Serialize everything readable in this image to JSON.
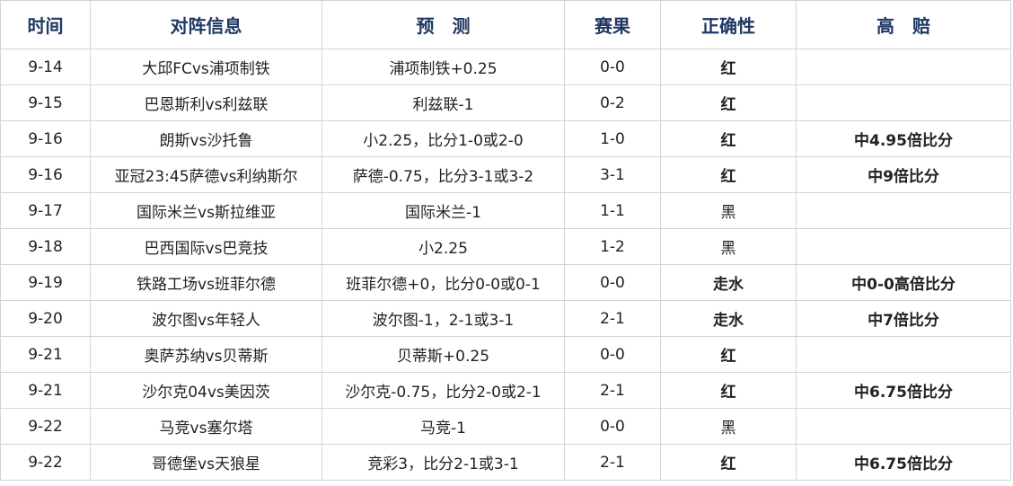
{
  "colors": {
    "header_text": "#1f3864",
    "red": "#e32020",
    "blue": "#1ba1e2",
    "black": "#222222",
    "grid": "#d4d4d4"
  },
  "headers": [
    "时间",
    "对阵信息",
    "预　测",
    "赛果",
    "正确性",
    "高　赔"
  ],
  "rows": [
    {
      "date": "9-14",
      "match": "大邱FCvs浦项制铁",
      "prediction": "浦项制铁+0.25",
      "score": "0-0",
      "result": "红",
      "result_type": "red",
      "odds": ""
    },
    {
      "date": "9-15",
      "match": "巴恩斯利vs利兹联",
      "prediction": "利兹联-1",
      "score": "0-2",
      "result": "红",
      "result_type": "red",
      "odds": ""
    },
    {
      "date": "9-16",
      "match": "朗斯vs沙托鲁",
      "prediction": "小2.25，比分1-0或2-0",
      "score": "1-0",
      "result": "红",
      "result_type": "red",
      "odds": "中4.95倍比分"
    },
    {
      "date": "9-16",
      "match": "亚冠23:45萨德vs利纳斯尔",
      "prediction": "萨德-0.75，比分3-1或3-2",
      "score": "3-1",
      "result": "红",
      "result_type": "red",
      "odds": "中9倍比分"
    },
    {
      "date": "9-17",
      "match": "国际米兰vs斯拉维亚",
      "prediction": "国际米兰-1",
      "score": "1-1",
      "result": "黑",
      "result_type": "black",
      "odds": ""
    },
    {
      "date": "9-18",
      "match": "巴西国际vs巴竞技",
      "prediction": "小2.25",
      "score": "1-2",
      "result": "黑",
      "result_type": "black",
      "odds": ""
    },
    {
      "date": "9-19",
      "match": "铁路工场vs班菲尔德",
      "prediction": "班菲尔德+0，比分0-0或0-1",
      "score": "0-0",
      "result": "走水",
      "result_type": "blue",
      "odds": "中0-0高倍比分"
    },
    {
      "date": "9-20",
      "match": "波尔图vs年轻人",
      "prediction": "波尔图-1，2-1或3-1",
      "score": "2-1",
      "result": "走水",
      "result_type": "blue",
      "odds": "中7倍比分"
    },
    {
      "date": "9-21",
      "match": "奥萨苏纳vs贝蒂斯",
      "prediction": "贝蒂斯+0.25",
      "score": "0-0",
      "result": "红",
      "result_type": "red",
      "odds": ""
    },
    {
      "date": "9-21",
      "match": "沙尔克04vs美因茨",
      "prediction": "沙尔克-0.75，比分2-0或2-1",
      "score": "2-1",
      "result": "红",
      "result_type": "red",
      "odds": "中6.75倍比分"
    },
    {
      "date": "9-22",
      "match": "马竞vs塞尔塔",
      "prediction": "马竞-1",
      "score": "0-0",
      "result": "黑",
      "result_type": "black",
      "odds": ""
    },
    {
      "date": "9-22",
      "match": "哥德堡vs天狼星",
      "prediction": "竞彩3，比分2-1或3-1",
      "score": "2-1",
      "result": "红",
      "result_type": "red",
      "odds": "中6.75倍比分"
    }
  ]
}
